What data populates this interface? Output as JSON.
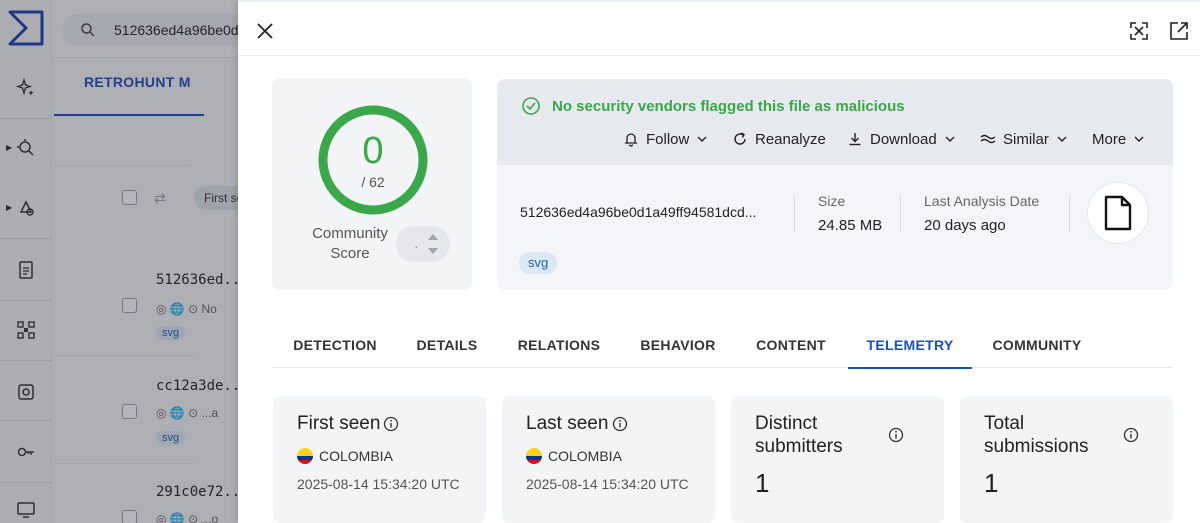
{
  "background": {
    "search_text": "512636ed4a96be0d",
    "tab_label": "RETROHUNT M",
    "filter_pill": "First se",
    "rows": [
      {
        "hash": "512636ed..",
        "detail": "No",
        "tag": "svg"
      },
      {
        "hash": "cc12a3de..",
        "detail": "...a",
        "tag": "svg"
      },
      {
        "hash": "291c0e72..",
        "detail": "...o",
        "tag": ""
      }
    ]
  },
  "header": {
    "close_icon": "close-icon",
    "expand_icon": "expand-icon",
    "open_new_icon": "open-in-new-icon"
  },
  "score": {
    "value": "0",
    "total": "/ 62",
    "community_label": "Community Score",
    "ring_color": "#3aa84a"
  },
  "summary": {
    "status": "No security vendors flagged this file as malicious",
    "actions": {
      "follow": "Follow",
      "reanalyze": "Reanalyze",
      "download": "Download",
      "similar": "Similar",
      "more": "More"
    },
    "hash": "512636ed4a96be0d1a49ff94581dcd...",
    "size_label": "Size",
    "size_value": "24.85 MB",
    "date_label": "Last Analysis Date",
    "date_value": "20 days ago",
    "tag": "svg"
  },
  "tabs": [
    {
      "label": "DETECTION"
    },
    {
      "label": "DETAILS"
    },
    {
      "label": "RELATIONS"
    },
    {
      "label": "BEHAVIOR"
    },
    {
      "label": "CONTENT"
    },
    {
      "label": "TELEMETRY",
      "active": true
    },
    {
      "label": "COMMUNITY"
    }
  ],
  "telemetry": {
    "first_seen": {
      "title": "First seen",
      "country": "COLOMBIA",
      "date": "2025-08-14 15:34:20 UTC"
    },
    "last_seen": {
      "title": "Last seen",
      "country": "COLOMBIA",
      "date": "2025-08-14 15:34:20 UTC"
    },
    "distinct": {
      "title_1": "Distinct",
      "title_2": "submitters",
      "value": "1"
    },
    "total": {
      "title_1": "Total",
      "title_2": "submissions",
      "value": "1"
    }
  },
  "colors": {
    "accent": "#1a4fbf",
    "success": "#3aa84a"
  }
}
